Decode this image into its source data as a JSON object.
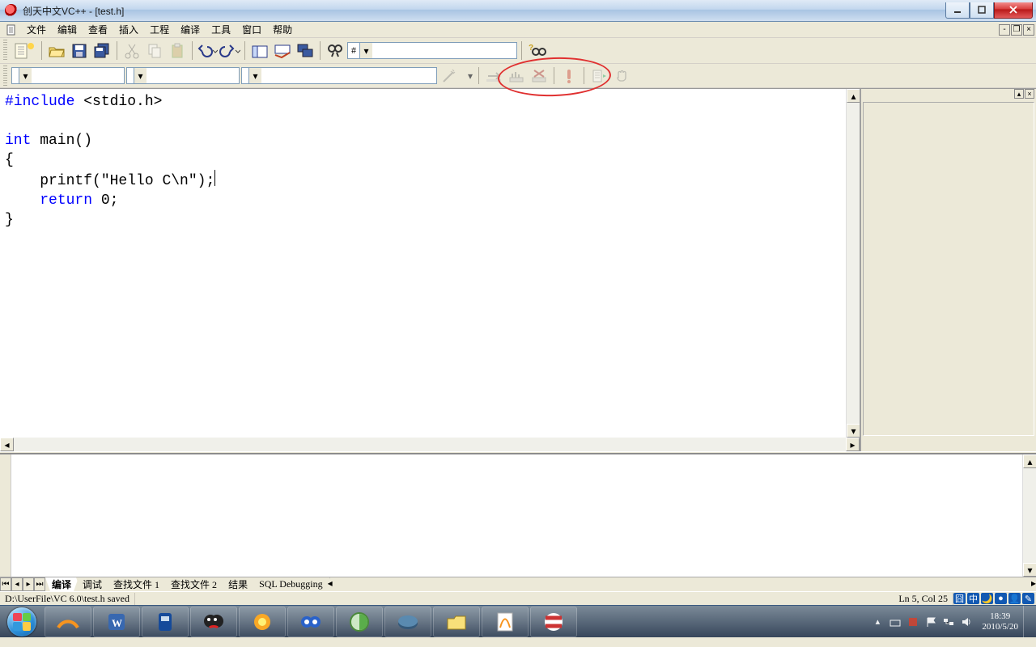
{
  "window": {
    "title": "创天中文VC++ - [test.h]"
  },
  "menu": {
    "file": "文件",
    "edit": "编辑",
    "view": "查看",
    "insert": "插入",
    "project": "工程",
    "compile": "编译",
    "tools": "工具",
    "window": "窗口",
    "help": "帮助"
  },
  "toolbar1": {
    "find_combo": "#"
  },
  "code": {
    "l1a": "#include",
    "l1b": " <stdio.h>",
    "l3a": "int",
    "l3b": " main()",
    "l4": "{",
    "l5a": "    printf(",
    "l5b": "\"Hello C\\n\"",
    "l5c": ");",
    "l6a": "    ",
    "l6b": "return",
    "l6c": " 0;",
    "l7": "}"
  },
  "output_tabs": {
    "t1": "编译",
    "t2": "调试",
    "t3": "查找文件 1",
    "t4": "查找文件 2",
    "t5": "结果",
    "t6": "SQL Debugging"
  },
  "status": {
    "path": "D:\\UserFile\\VC 6.0\\test.h saved",
    "pos": "Ln 5, Col 25"
  },
  "ime": {
    "a": "囧",
    "b": "中",
    "c": "🌙",
    "d": "●",
    "e": "👤",
    "f": "✎"
  },
  "clock": {
    "time": "18:39",
    "date": "2010/5/20"
  }
}
